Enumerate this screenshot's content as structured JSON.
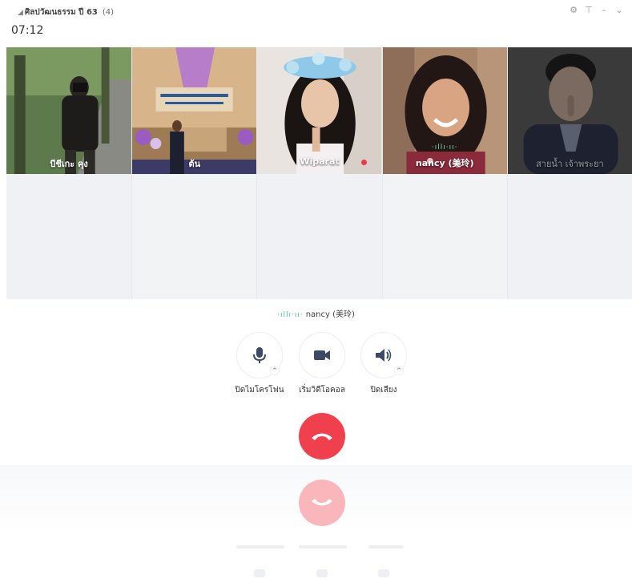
{
  "window": {
    "title": "ศิลปวัฒนธรรม ปี 63",
    "member_count": "(4)",
    "controls": {
      "settings": "⚙",
      "pin": "⊤",
      "minimize": "–",
      "close": "⌄"
    }
  },
  "call": {
    "timer": "07:12",
    "active_speaker": "nancy (美玲)",
    "speaker_wave": "·ıllı·ıı·",
    "participants": [
      {
        "name": "บีชีเกะ คุง",
        "speaking": false,
        "muted": false,
        "dimmed": false
      },
      {
        "name": "ต้น",
        "speaking": false,
        "muted": false,
        "dimmed": false
      },
      {
        "name": "Wiparat",
        "speaking": false,
        "muted": true,
        "dimmed": false
      },
      {
        "name": "nancy (美玲)",
        "speaking": true,
        "muted": false,
        "dimmed": false,
        "wave": "·ıllı·ıı·"
      },
      {
        "name": "สายน้ำ เจ้าพระยา",
        "speaking": false,
        "muted": false,
        "dimmed": true
      }
    ]
  },
  "controls": {
    "mic_label": "ปิดไมโครโฟน",
    "video_label": "เริ่มวิดีโอคอล",
    "speaker_label": "ปิดเสียง",
    "caret": "^"
  },
  "colors": {
    "hangup": "#f0404e",
    "control_icon": "#3c4a66",
    "speaking_wave": "#3fbf8f",
    "mute_dot": "#e83a4a"
  },
  "icons": {
    "mic": "microphone-icon",
    "video": "video-camera-icon",
    "speaker": "speaker-icon",
    "hangup": "phone-hangup-icon"
  }
}
